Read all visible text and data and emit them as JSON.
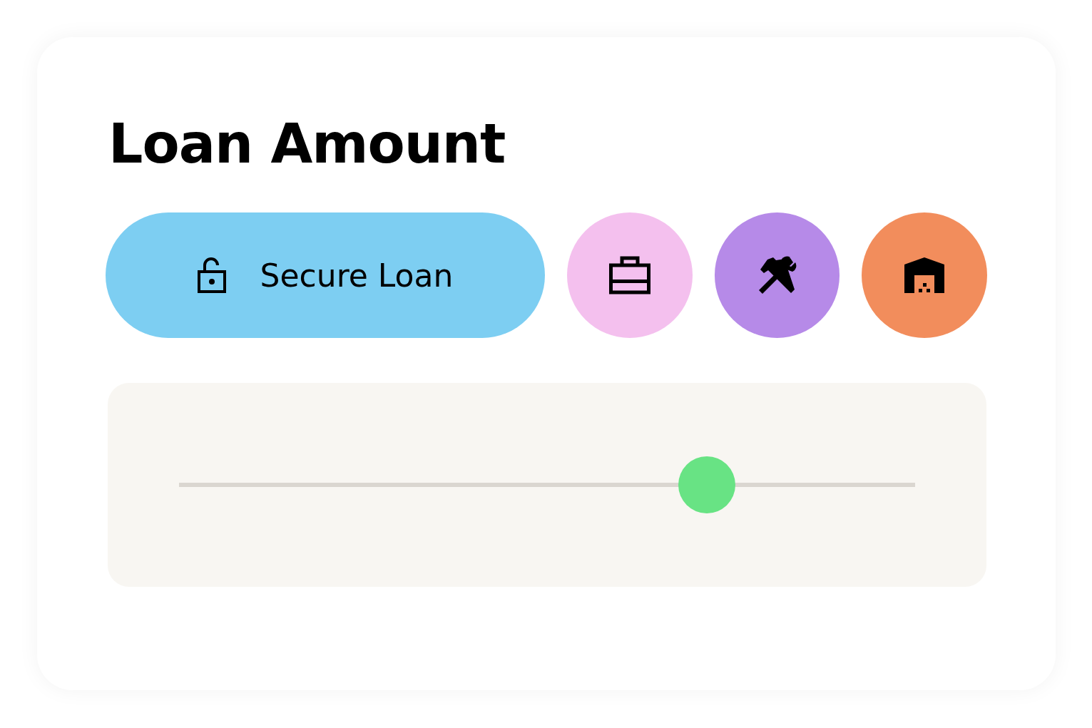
{
  "title": "Loan Amount",
  "actions": [
    {
      "kind": "labeled",
      "label": "Secure Loan",
      "color": "#7dcef2"
    },
    {
      "kind": "briefcase",
      "color": "#f4c0ee"
    },
    {
      "kind": "tools",
      "color": "#b68ae8"
    },
    {
      "kind": "warehouse",
      "color": "#f28d5c"
    }
  ],
  "slider": {
    "level": 0.717
  }
}
